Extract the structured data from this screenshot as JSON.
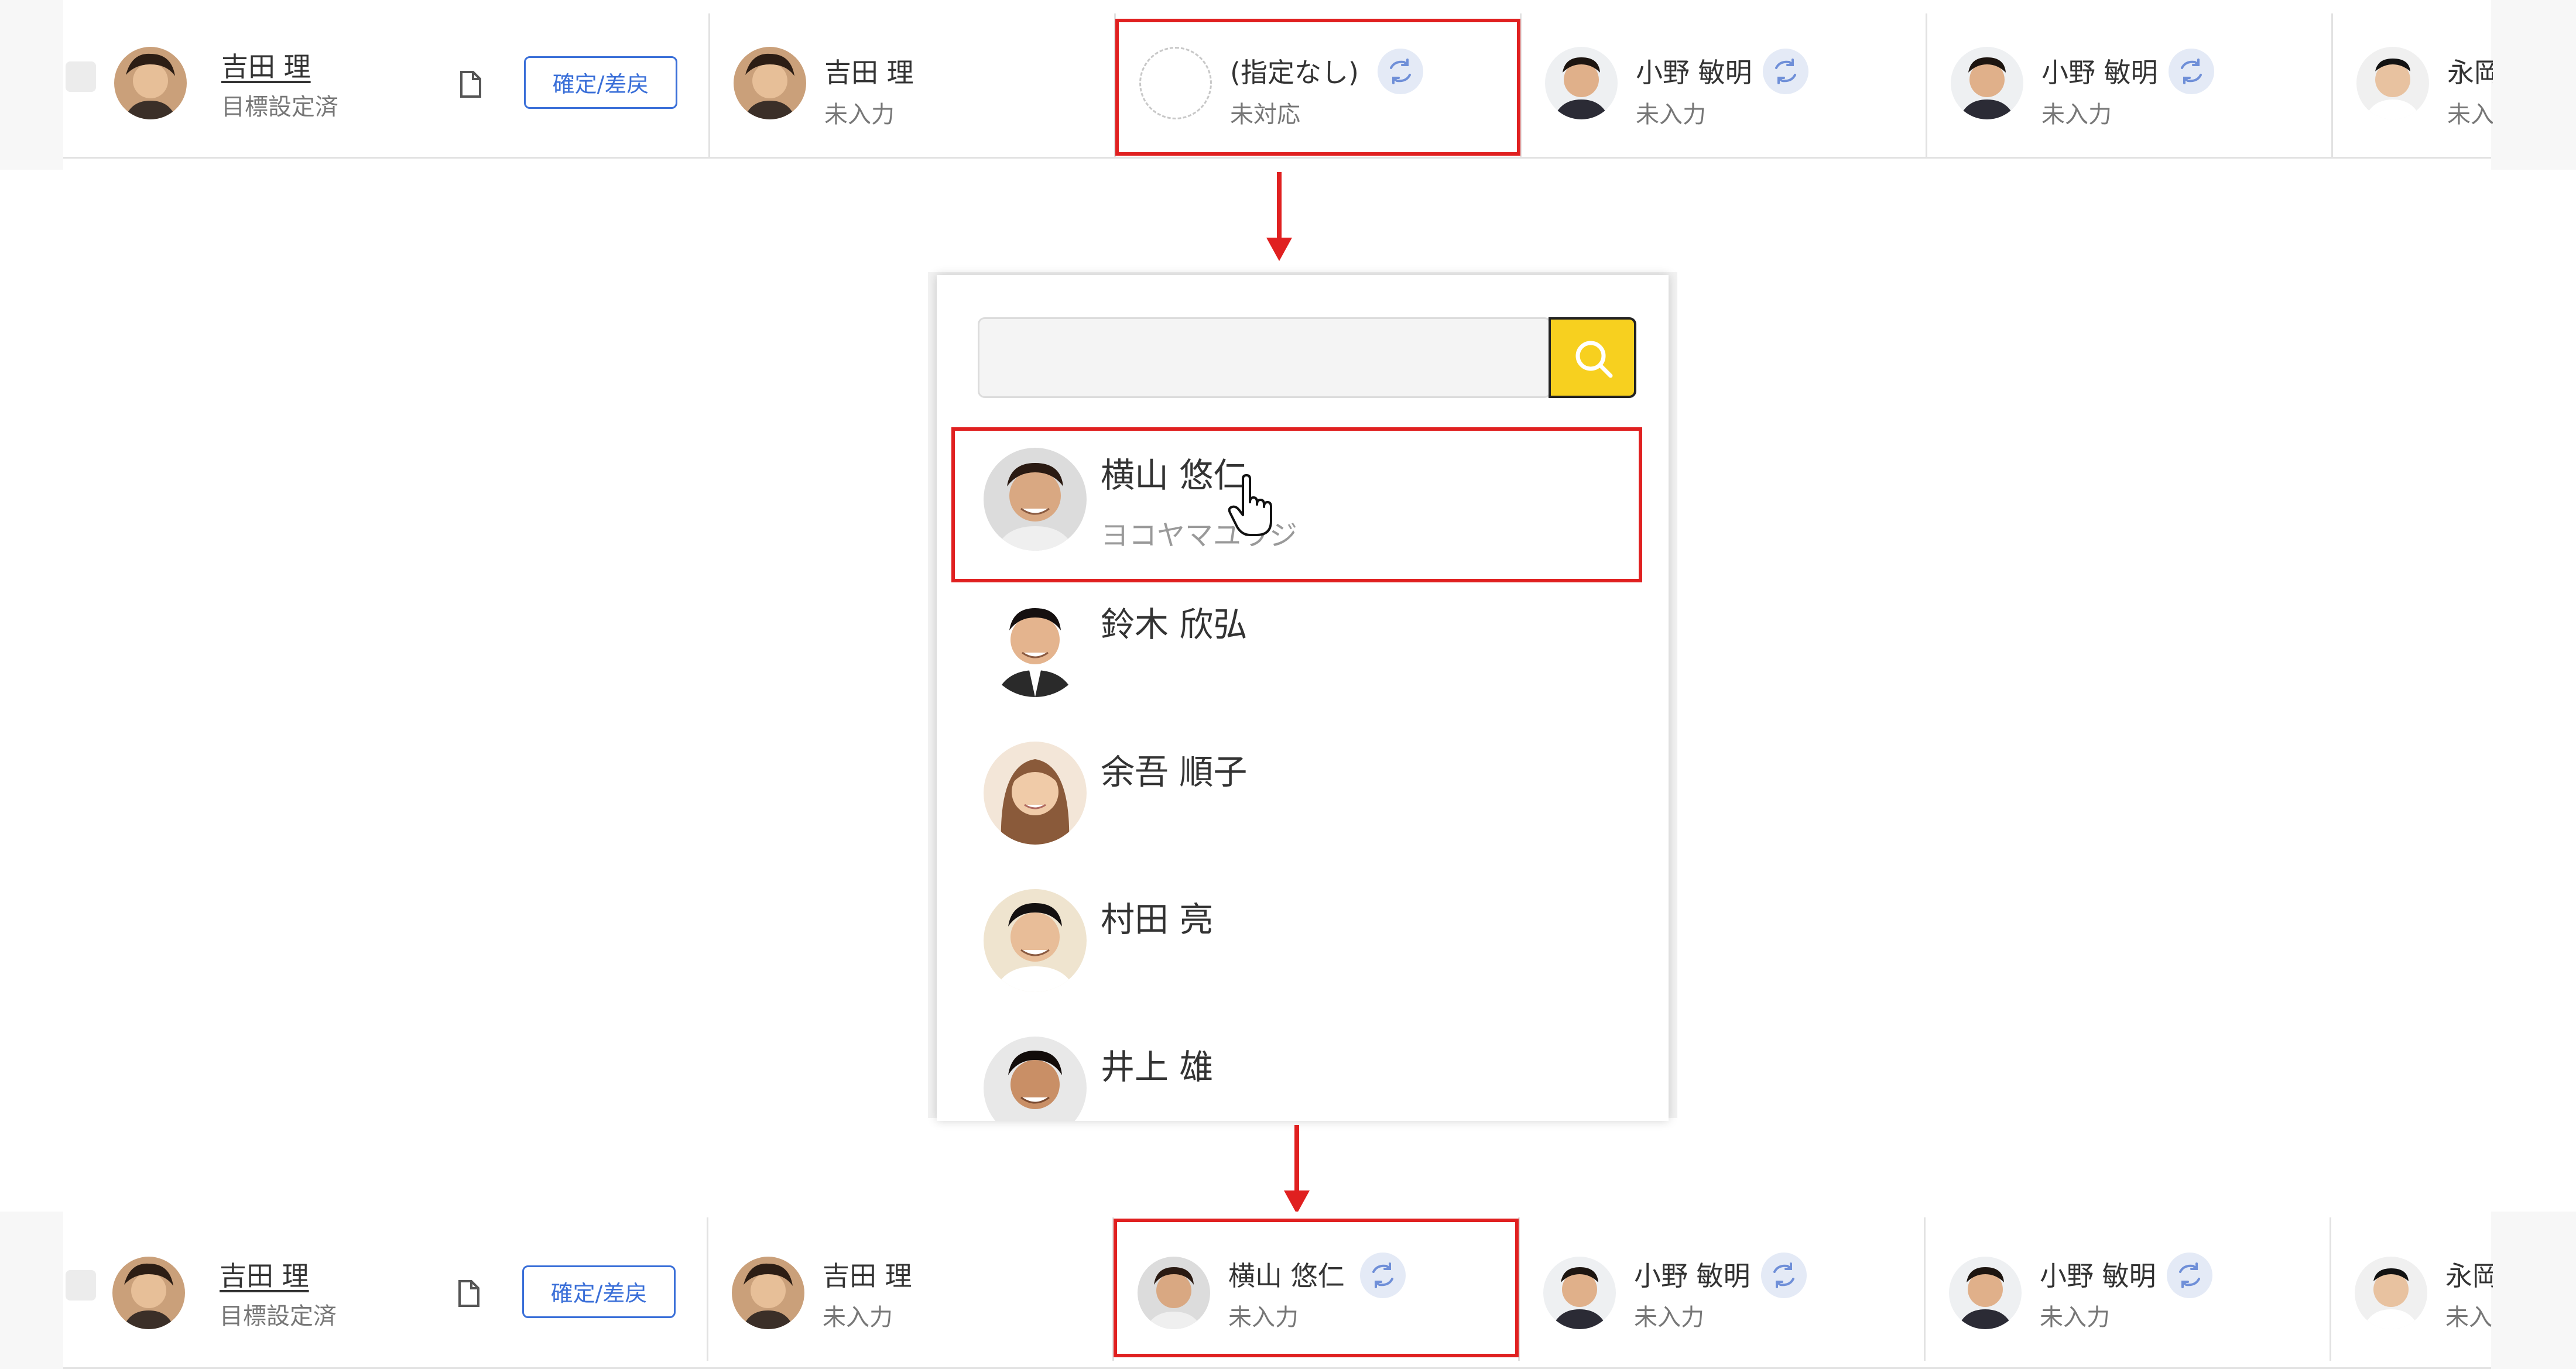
{
  "top_row": {
    "owner": {
      "name": "吉田 理",
      "status": "目標設定済"
    },
    "confirm_button": "確定/差戻",
    "cells": [
      {
        "name": "吉田 理",
        "status": "未入力"
      },
      {
        "name": "(指定なし)",
        "status": "未対応"
      },
      {
        "name": "小野 敏明",
        "status": "未入力"
      },
      {
        "name": "小野 敏明",
        "status": "未入力"
      },
      {
        "name": "永岡",
        "status": "未入"
      }
    ]
  },
  "dropdown": {
    "search": {
      "value": "",
      "placeholder": ""
    },
    "items": [
      {
        "name": "横山 悠仁",
        "kana": "ヨコヤマユウジ"
      },
      {
        "name": "鈴木 欣弘",
        "kana": ""
      },
      {
        "name": "余吾 順子",
        "kana": ""
      },
      {
        "name": "村田 亮",
        "kana": ""
      },
      {
        "name": "井上 雄",
        "kana": ""
      }
    ]
  },
  "bottom_row": {
    "owner": {
      "name": "吉田 理",
      "status": "目標設定済"
    },
    "confirm_button": "確定/差戻",
    "cells": [
      {
        "name": "吉田 理",
        "status": "未入力"
      },
      {
        "name": "横山 悠仁",
        "status": "未入力"
      },
      {
        "name": "小野 敏明",
        "status": "未入力"
      },
      {
        "name": "小野 敏明",
        "status": "未入力"
      },
      {
        "name": "永岡",
        "status": "未入"
      }
    ]
  },
  "colors": {
    "highlight": "#e02020",
    "accent": "#3a6fd8",
    "search_button": "#f7d01f",
    "swap_bg": "#e4eaf6"
  },
  "icons": [
    "document-icon",
    "swap-icon",
    "search-icon",
    "pointer-hand-icon",
    "arrow-down-icon"
  ]
}
